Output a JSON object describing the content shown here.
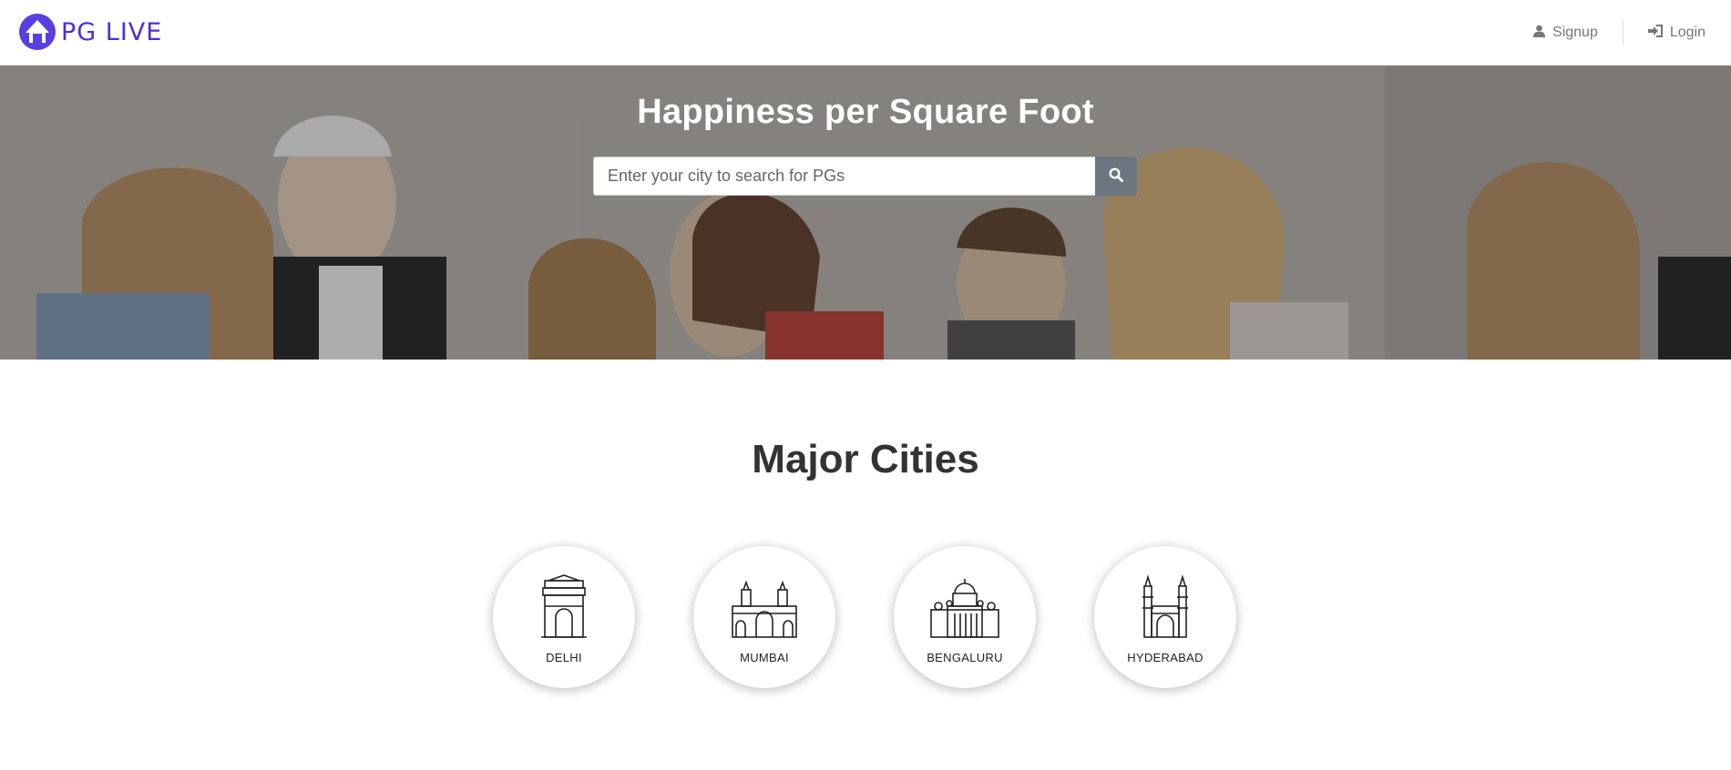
{
  "brand": {
    "name": "PG LIVE",
    "logo_icon": "house-logo-icon"
  },
  "nav": {
    "signup_label": "Signup",
    "signup_icon": "user-icon",
    "login_label": "Login",
    "login_icon": "sign-in-icon"
  },
  "hero": {
    "title": "Happiness per Square Foot",
    "search_placeholder": "Enter your city to search for PGs",
    "search_icon": "search-icon"
  },
  "major_cities": {
    "title": "Major Cities",
    "cities": [
      {
        "label": "DELHI",
        "icon": "india-gate-icon"
      },
      {
        "label": "MUMBAI",
        "icon": "gateway-of-india-icon"
      },
      {
        "label": "BENGALURU",
        "icon": "vidhana-soudha-icon"
      },
      {
        "label": "HYDERABAD",
        "icon": "charminar-icon"
      }
    ]
  },
  "colors": {
    "brand": "#4b2fd8",
    "search_button": "#6c7580"
  }
}
